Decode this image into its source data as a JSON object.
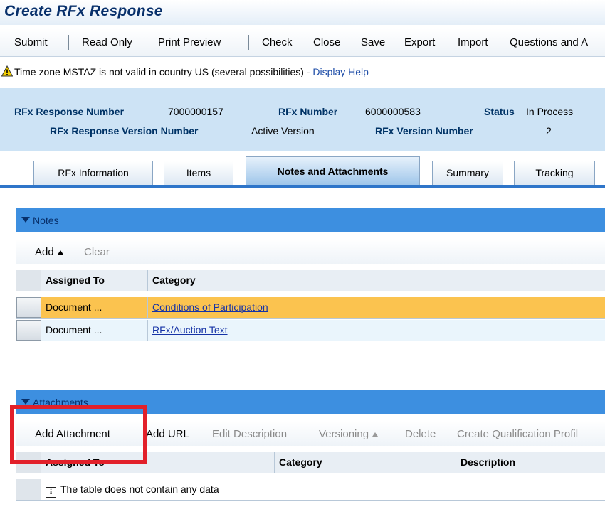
{
  "window": {
    "title": "Create RFx Response"
  },
  "toolbar": {
    "buttons": [
      "Submit",
      "Read Only",
      "Print Preview",
      "Check",
      "Close",
      "Save",
      "Export",
      "Import",
      "Questions and A"
    ]
  },
  "message": {
    "text": "Time zone MSTAZ is not valid in country US (several possibilities) - ",
    "link": "Display Help"
  },
  "header": {
    "response_number_label": "RFx Response Number",
    "response_number": "7000000157",
    "rfx_number_label": "RFx Number",
    "rfx_number": "6000000583",
    "status_label": "Status",
    "status": "In Process",
    "response_version_label": "RFx Response Version Number",
    "response_version": "Active Version",
    "rfx_version_label": "RFx Version Number",
    "rfx_version": "2"
  },
  "tabs": [
    "RFx Information",
    "Items",
    "Notes and Attachments",
    "Summary",
    "Tracking"
  ],
  "notes": {
    "title": "Notes",
    "toolbar": {
      "add": "Add",
      "clear": "Clear"
    },
    "columns": [
      "Assigned To",
      "Category"
    ],
    "rows": [
      {
        "assigned_to": "Document ...",
        "category": "Conditions of Participation"
      },
      {
        "assigned_to": "Document ...",
        "category": "RFx/Auction Text"
      }
    ]
  },
  "attachments": {
    "title": "Attachments",
    "toolbar": {
      "add_attachment": "Add Attachment",
      "add_url": "Add URL",
      "edit_description": "Edit Description",
      "versioning": "Versioning",
      "delete": "Delete",
      "create_qualification": "Create Qualification Profil"
    },
    "columns": [
      "Assigned To",
      "Category",
      "Description"
    ],
    "empty_text": "The table does not contain any data"
  },
  "colors": {
    "accent": "#3d8fe0",
    "highlight": "#e2202a",
    "selected_row": "#fbc34f"
  }
}
